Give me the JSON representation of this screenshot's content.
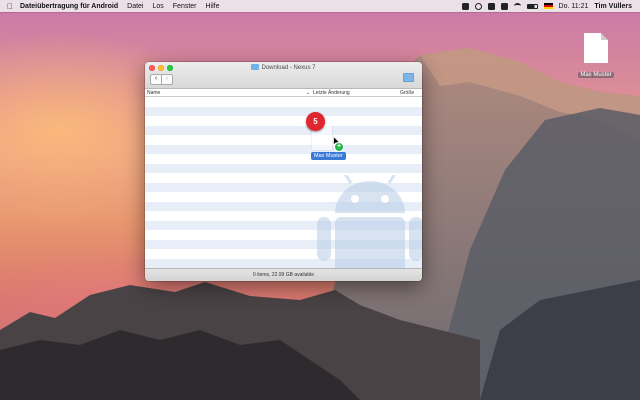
{
  "menubar": {
    "apple_icon": "apple-logo",
    "app_name": "Dateiübertragung für Android",
    "menus": [
      "Datei",
      "Los",
      "Fenster",
      "Hilfe"
    ],
    "clock": "Do. 11:21",
    "user": "Tim Vüllers",
    "status_icons": [
      "camera-icon",
      "scan-icon",
      "dropbox-icon",
      "box-icon",
      "wifi-icon",
      "battery-icon",
      "flag-icon"
    ]
  },
  "desktop": {
    "file_label": "Max Muster"
  },
  "window": {
    "title": "Download - Nexus 7",
    "back_glyph": "‹",
    "forward_glyph": "›",
    "columns": {
      "name": "Name",
      "modified": "Letzte Änderung",
      "size": "Größe"
    },
    "sort_indicator": "⌄",
    "status": "0 items, 22.99 GB available"
  },
  "drag": {
    "badge_count": "5",
    "plus": "+",
    "label": "Max Muster"
  },
  "colors": {
    "row_alt": "#e7eef8",
    "close": "#fc5f57",
    "minimize": "#fdbc2e",
    "zoom": "#29c940",
    "badge": "#e0262e",
    "copy": "#22b84a",
    "selection": "#3a79d6"
  }
}
